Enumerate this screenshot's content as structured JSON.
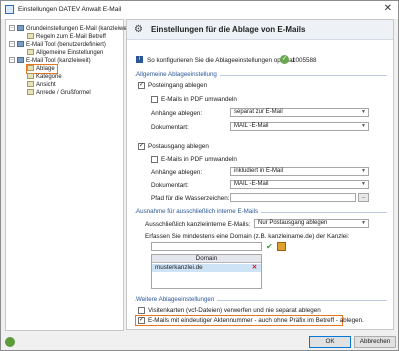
{
  "window": {
    "title": "Einstellungen DATEV Anwalt E-Mail",
    "close_glyph": "✕"
  },
  "tree": {
    "items": [
      {
        "label": "Grundeinstellungen E-Mail (kanzleiweit)"
      },
      {
        "label": "Regeln zum E-Mail Betreff"
      },
      {
        "label": "E-Mail Tool (benutzerdefiniert)"
      },
      {
        "label": "Allgemeine Einstellungen"
      },
      {
        "label": "E-Mail Tool (kanzleiweit)"
      },
      {
        "label": "Ablage"
      },
      {
        "label": "Kategorie"
      },
      {
        "label": "Ansicht"
      },
      {
        "label": "Anrede / Grußformel"
      }
    ]
  },
  "panel": {
    "title": "Einstellungen für die Ablage von E-Mails",
    "info_text": "So konfigurieren Sie die Ablageeinstellungen optimal:",
    "info_doc": "1005588",
    "sec_general": "Allgemeine Ablageeinstellung",
    "in": {
      "checkbox": "Posteingang ablegen",
      "pdf": "E-Mails in PDF umwandeln",
      "attach_label": "Anhänge ablegen:",
      "attach_value": "separat zur E-Mail",
      "doc_label": "Dokumentart:",
      "doc_value": "MAIL -E-Mail"
    },
    "out": {
      "checkbox": "Postausgang ablegen",
      "pdf": "E-Mails in PDF umwandeln",
      "attach_label": "Anhänge ablegen:",
      "attach_value": "inkludiert in E-Mail",
      "doc_label": "Dokumentart:",
      "doc_value": "MAIL -E-Mail",
      "path_label": "Pfad für die Wasserzeichen:",
      "browse": "..."
    },
    "sec_internal": "Ausnahme für ausschließlich interne E-Mails",
    "internal": {
      "label": "Ausschließlich kanzleiinterne E-Mails:",
      "value": "Nur Postausgang ablegen",
      "domain_hint": "Erfassen Sie mindestens eine Domain (z.B. kanzleiname.de) der Kanzlei:",
      "table_header": "Domain",
      "rows": [
        "musterkanzlei.de"
      ]
    },
    "sec_more": "Weitere Ablageeinstellungen",
    "more": {
      "vcf": "Visitenkarten (vcf-Dateien) verwerfen und nie separat ablegen",
      "akten": "E-Mails mit eindeutiger Aktennummer - auch ohne Präfix im Betreff - ablegen."
    }
  },
  "buttons": {
    "ok": "OK",
    "cancel": "Abbrechen"
  },
  "colors": {
    "highlight": "#e87722",
    "section": "#2b5797"
  }
}
